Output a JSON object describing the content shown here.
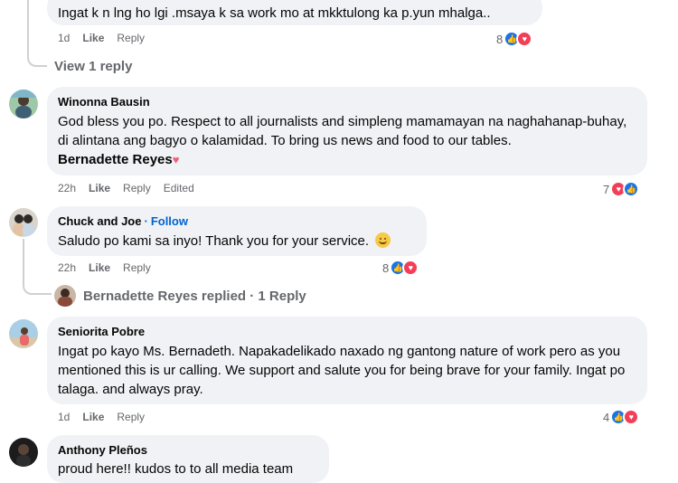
{
  "comments": [
    {
      "text": "Ingat k n lng ho lgi .msaya k sa work mo at mkktulong ka p.yun mhalga..",
      "time": "1d",
      "like": "Like",
      "reply": "Reply",
      "reaction_count": "8",
      "view_replies": "View 1 reply"
    },
    {
      "author": "Winonna Bausin",
      "text": "God bless you po. Respect to all journalists and simpleng mamamayan na naghahanap-buhay, di alintana ang bagyo o kalamidad. To bring us news and food to our tables.",
      "mention": "Bernadette Reyes",
      "time": "22h",
      "like": "Like",
      "reply": "Reply",
      "edited": "Edited",
      "reaction_count": "7"
    },
    {
      "author": "Chuck and Joe",
      "separator": "·",
      "follow": "Follow",
      "text": "Saludo po kami sa inyo! Thank you for your service.",
      "time": "22h",
      "like": "Like",
      "reply": "Reply",
      "reaction_count": "8",
      "replied_text": "Bernadette Reyes replied · 1 Reply"
    },
    {
      "author": "Seniorita Pobre",
      "text": "Ingat po kayo Ms. Bernadeth. Napakadelikado naxado ng gantong nature of work pero as you mentioned this is ur calling. We support and salute you for being brave for your family. Ingat po talaga. and always pray.",
      "time": "1d",
      "like": "Like",
      "reply": "Reply",
      "reaction_count": "4"
    },
    {
      "author": "Anthony Pleños",
      "text": "proud here!! kudos to to all media team"
    }
  ],
  "colors": {
    "bubble": "#f0f2f5",
    "meta": "#65676b",
    "follow": "#0064d1",
    "like": "#1b74e4",
    "love": "#f33e58"
  },
  "icons": {
    "like": "thumbs-up-icon",
    "love": "heart-icon",
    "emoji": "smiling-face-emoji",
    "heart_emoji": "pink-heart-emoji"
  }
}
